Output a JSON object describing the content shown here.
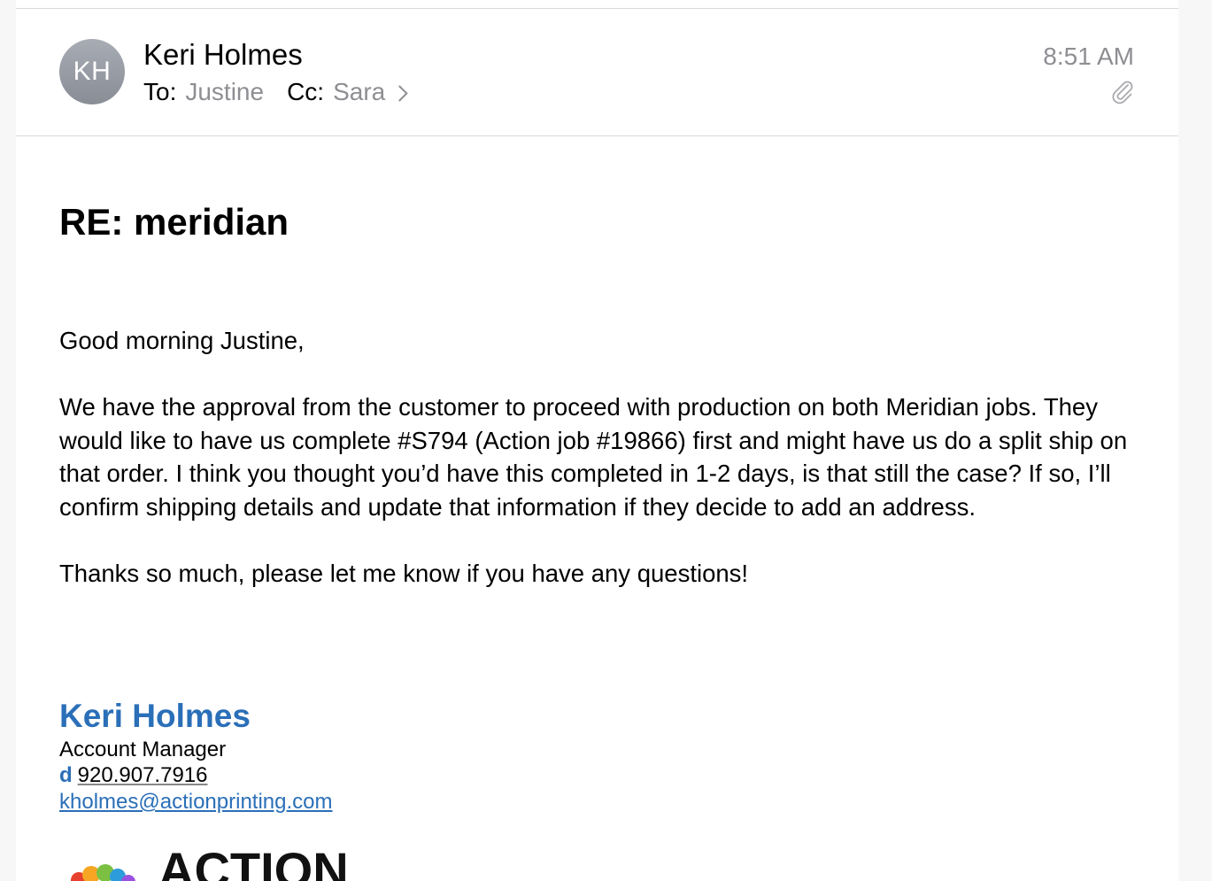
{
  "message": {
    "sender": {
      "initials": "KH",
      "name": "Keri Holmes"
    },
    "to_label": "To:",
    "to": "Justine",
    "cc_label": "Cc:",
    "cc": "Sara",
    "time": "8:51 AM",
    "has_attachment": true,
    "subject": "RE: meridian",
    "body": {
      "greeting": "Good morning Justine,",
      "paragraph1": "We have the approval from the customer to proceed with production on both Meridian jobs. They would like to have us complete #S794 (Action job #19866) first and might have us do a split ship on that order. I think you thought you’d have this completed in 1-2 days, is that still the case? If so, I’ll confirm shipping details and update that information if they decide to add an address.",
      "paragraph2": "Thanks so much, please let me know if you have any questions!"
    },
    "signature": {
      "name": "Keri Holmes",
      "title": "Account Manager",
      "phone_prefix": "d",
      "phone": "920.907.7916",
      "email": "kholmes@actionprinting.com",
      "logo_text": "ACTION"
    }
  },
  "colors": {
    "link_blue": "#2a6fb8",
    "secondary_gray": "#8e8e93",
    "divider": "#d8d8d8"
  },
  "icons": {
    "attachment": "paperclip-icon",
    "details": "chevron-right-icon"
  }
}
